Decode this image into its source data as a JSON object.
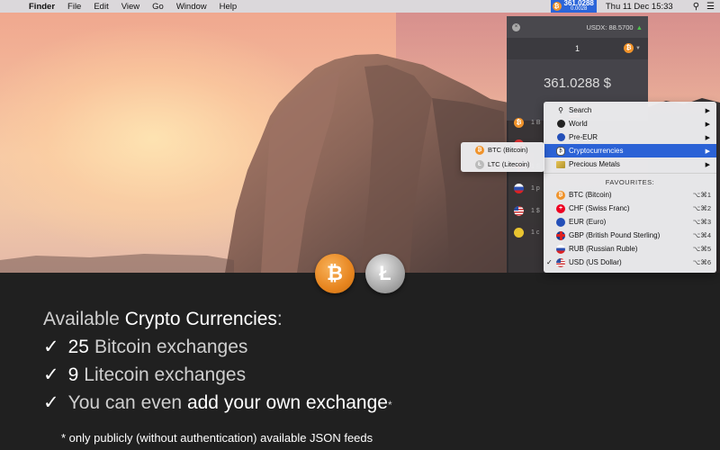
{
  "menubar": {
    "apple_icon": "apple-logo",
    "items": [
      "Finder",
      "File",
      "Edit",
      "View",
      "Go",
      "Window",
      "Help"
    ],
    "widget_value": "361.0288",
    "widget_sub": "0.0028",
    "clock": "Thu 11 Dec  15:33"
  },
  "panel": {
    "usdx_label": "USDX: 88.5700",
    "amount": "1",
    "result": "361.0288 $",
    "list_items": [
      "1 B",
      "",
      "1 E",
      "1 p",
      "1 $",
      "1 c"
    ]
  },
  "menu": {
    "items": [
      {
        "label": "Search",
        "icon": "search-icon"
      },
      {
        "label": "World",
        "icon": "globe-icon"
      },
      {
        "label": "Pre-EUR",
        "icon": "eu-icon"
      },
      {
        "label": "Cryptocurrencies",
        "icon": "crypto-icon",
        "highlighted": true
      },
      {
        "label": "Precious Metals",
        "icon": "metal-icon"
      }
    ],
    "favourites_header": "FAVOURITES:",
    "favourites": [
      {
        "label": "BTC (Bitcoin)",
        "shortcut": "⌥⌘1"
      },
      {
        "label": "CHF (Swiss Franc)",
        "shortcut": "⌥⌘2"
      },
      {
        "label": "EUR (Euro)",
        "shortcut": "⌥⌘3"
      },
      {
        "label": "GBP (British Pound Sterling)",
        "shortcut": "⌥⌘4"
      },
      {
        "label": "RUB (Russian Ruble)",
        "shortcut": "⌥⌘5"
      },
      {
        "label": "USD (US Dollar)",
        "shortcut": "⌥⌘6",
        "checked": true
      }
    ]
  },
  "submenu": {
    "items": [
      "BTC (Bitcoin)",
      "LTC (Litecoin)"
    ]
  },
  "promo": {
    "headline_light": "Available ",
    "headline_bold": "Crypto Currencies",
    "headline_colon": ":",
    "line1_num": "25",
    "line1_text": "Bitcoin exchanges",
    "line2_num": "9",
    "line2_text": "Litecoin exchanges",
    "line3_light": "You can even ",
    "line3_bold": "add your own exchange",
    "line3_star": "*",
    "footnote": "* only publicly (without authentication) available JSON feeds"
  },
  "colors": {
    "highlight": "#2b62d6",
    "bitcoin": "#f0932b",
    "up_arrow": "#4cc24c"
  }
}
